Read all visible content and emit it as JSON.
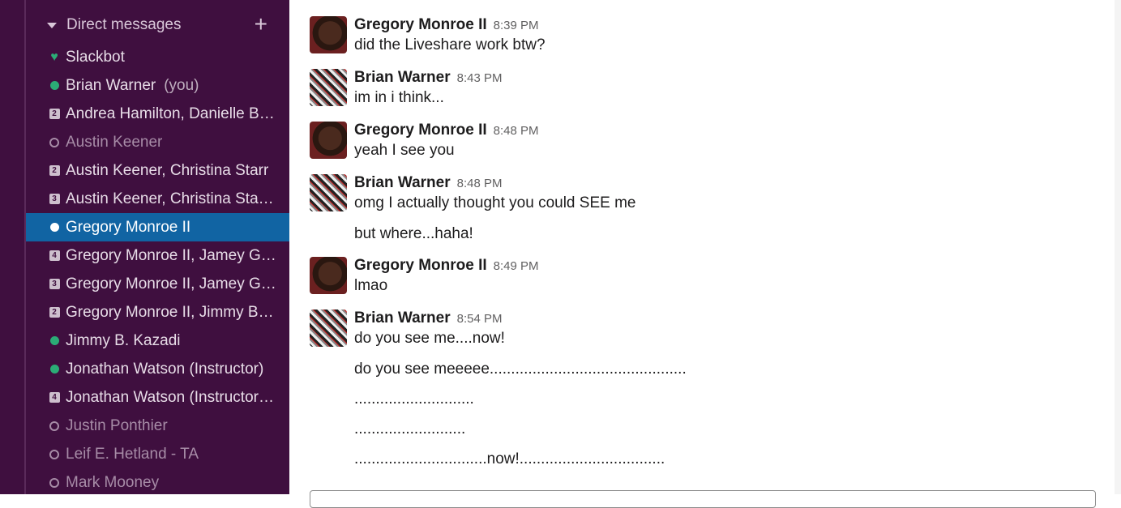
{
  "sidebar": {
    "section_title": "Direct messages",
    "add_label": "+",
    "items": [
      {
        "label": "Slackbot",
        "status": "heart",
        "you": ""
      },
      {
        "label": "Brian Warner",
        "status": "online",
        "you": "(you)"
      },
      {
        "label": "Andrea Hamilton, Danielle By...",
        "status": "count",
        "count": "2",
        "you": ""
      },
      {
        "label": "Austin Keener",
        "status": "away",
        "you": ""
      },
      {
        "label": "Austin Keener, Christina Starr",
        "status": "count",
        "count": "2",
        "you": ""
      },
      {
        "label": "Austin Keener, Christina Starr...",
        "status": "count",
        "count": "3",
        "you": ""
      },
      {
        "label": "Gregory Monroe II",
        "status": "active",
        "you": ""
      },
      {
        "label": "Gregory Monroe II, Jamey Gr...",
        "status": "count",
        "count": "4",
        "you": ""
      },
      {
        "label": "Gregory Monroe II, Jamey Gr...",
        "status": "count",
        "count": "3",
        "you": ""
      },
      {
        "label": "Gregory Monroe II, Jimmy B. ...",
        "status": "count",
        "count": "2",
        "you": ""
      },
      {
        "label": "Jimmy B. Kazadi",
        "status": "online",
        "you": ""
      },
      {
        "label": "Jonathan Watson (Instructor)",
        "status": "online",
        "you": ""
      },
      {
        "label": "Jonathan Watson (Instructor)...",
        "status": "count",
        "count": "4",
        "you": ""
      },
      {
        "label": "Justin Ponthier",
        "status": "away",
        "you": ""
      },
      {
        "label": "Leif E. Hetland - TA",
        "status": "away",
        "you": ""
      },
      {
        "label": "Mark Mooney",
        "status": "away",
        "you": ""
      }
    ]
  },
  "messages": [
    {
      "author": "Gregory Monroe II",
      "time": "8:39 PM",
      "avatar": "gregory",
      "lines": [
        "did the Liveshare work btw?"
      ]
    },
    {
      "author": "Brian Warner",
      "time": "8:43 PM",
      "avatar": "brian",
      "lines": [
        "im in i think..."
      ]
    },
    {
      "author": "Gregory Monroe II",
      "time": "8:48 PM",
      "avatar": "gregory",
      "lines": [
        "yeah I see you"
      ]
    },
    {
      "author": "Brian Warner",
      "time": "8:48 PM",
      "avatar": "brian",
      "lines": [
        "omg I actually thought you could SEE me",
        "but where...haha!"
      ]
    },
    {
      "author": "Gregory Monroe II",
      "time": "8:49 PM",
      "avatar": "gregory",
      "lines": [
        "lmao"
      ]
    },
    {
      "author": "Brian Warner",
      "time": "8:54 PM",
      "avatar": "brian",
      "lines": [
        "do you see me....now!",
        "do you see meeeee..............................................",
        "............................",
        "..........................",
        "...............................now!.................................."
      ]
    }
  ]
}
